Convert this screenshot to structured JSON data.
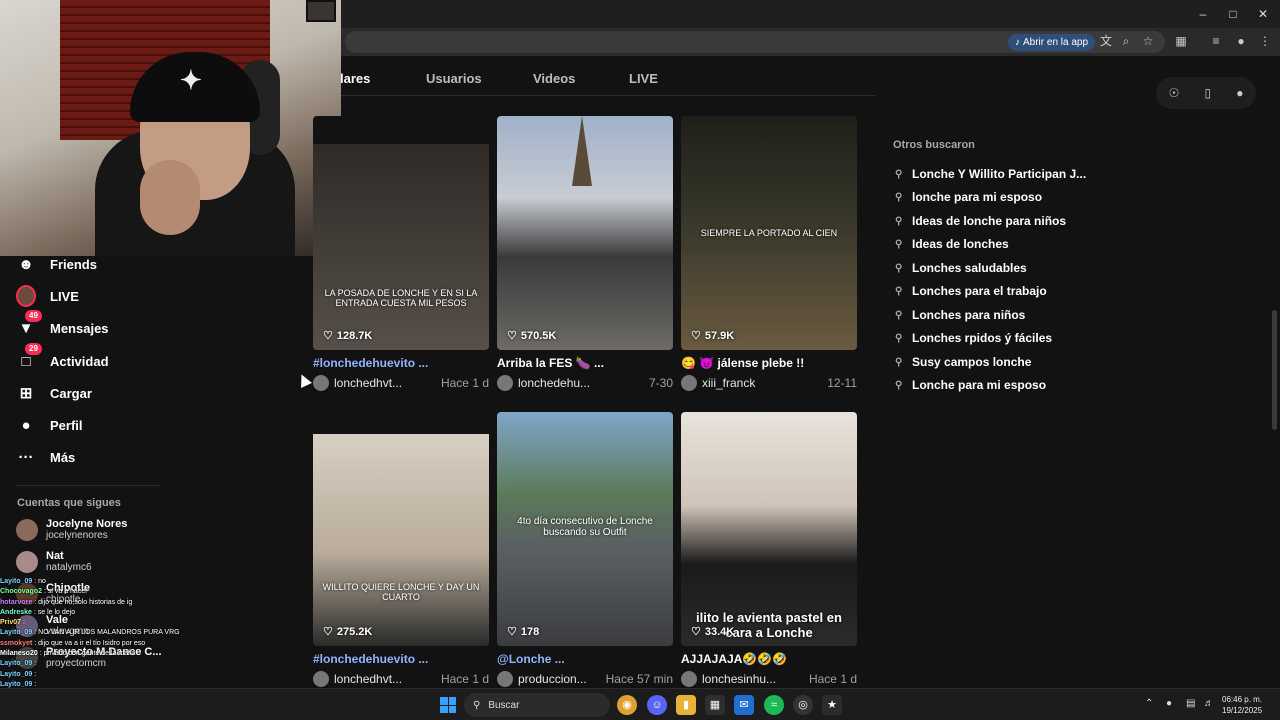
{
  "browser": {
    "open_app_label": "Abrir en la app"
  },
  "tabs": [
    {
      "label": "lares",
      "active": true
    },
    {
      "label": "Usuarios",
      "active": false
    },
    {
      "label": "Videos",
      "active": false
    },
    {
      "label": "LIVE",
      "active": false
    }
  ],
  "nav": {
    "friends": "Friends",
    "live": "LIVE",
    "messages": "Mensajes",
    "messages_badge": "49",
    "activity": "Actividad",
    "activity_badge": "29",
    "upload": "Cargar",
    "profile": "Perfil",
    "more": "Más"
  },
  "following": {
    "title": "Cuentas que sigues",
    "accounts": [
      {
        "name": "Jocelyne Nores",
        "user": "jocelynenores"
      },
      {
        "name": "Nat",
        "user": "natalymc6"
      },
      {
        "name": "Chipotle",
        "user": "chipotle"
      },
      {
        "name": "Vale",
        "user": "valevgmn"
      },
      {
        "name": "Proyecto M Dance C...",
        "user": "proyectomcm"
      }
    ]
  },
  "chat": [
    {
      "user": "Layito_09",
      "user_color": "#7ad3ff",
      "msg": "no"
    },
    {
      "user": "Chocovago2",
      "user_color": "#7aff9a",
      "msg": "si va a hacer"
    },
    {
      "user": "hotarvore",
      "user_color": "#c27aff",
      "msg": "dijo que no,solo historias de ig"
    },
    {
      "user": "Andreske",
      "user_color": "#7affd0",
      "msg": "se le lo dejo"
    },
    {
      "user": "Priv07",
      "user_color": "#ffe07a",
      "msg": ""
    },
    {
      "user": "Layito_09",
      "user_color": "#7ad3ff",
      "msg": "NO VAN A IR LOS MALANDROS PURA VRG"
    },
    {
      "user": "ssmokyet",
      "user_color": "#ff7a7a",
      "msg": "dijo que va a ir el tío Isidro por eso"
    },
    {
      "user": "Milaneso20",
      "user_color": "#ffffff",
      "msg": "privado con gente de la mafia"
    },
    {
      "user": "Layito_09",
      "user_color": "#7ad3ff",
      "msg": ""
    },
    {
      "user": "Layito_09",
      "user_color": "#7ad3ff",
      "msg": ""
    },
    {
      "user": "Layito_09",
      "user_color": "#7ad3ff",
      "msg": ""
    }
  ],
  "videos": [
    {
      "likes": "128.7K",
      "overlay": "LA POSADA DE LONCHE Y EN SI LA ENTRADA CUESTA MIL PESOS",
      "caption": "#lonchedehuevito ...",
      "is_tag": true,
      "user": "lonchedhvt...",
      "time": "Hace 1 d"
    },
    {
      "likes": "570.5K",
      "overlay": "",
      "caption": "Arriba la FES 🍆 ...",
      "is_tag": false,
      "user": "lonchedehu...",
      "time": "7-30"
    },
    {
      "likes": "57.9K",
      "overlay": "SIEMPRE LA PORTADO AL CIEN",
      "caption": "😋 😈 jálense plebe !!",
      "is_tag": false,
      "user": "xiii_franck",
      "time": "12-11"
    },
    {
      "likes": "275.2K",
      "overlay": "WILLITO QUIERE LONCHE Y DAY UN CUARTO",
      "caption": "#lonchedehuevito ...",
      "is_tag": true,
      "user": "lonchedhvt...",
      "time": "Hace 1 d"
    },
    {
      "likes": "178",
      "overlay": "4to día consecutivo de Lonche buscando su Outfit",
      "caption": "@Lonche ...",
      "is_tag": true,
      "user": "produccion...",
      "time": "Hace 57 min"
    },
    {
      "likes": "33.4K",
      "overlay": "ilito le avienta pastel en cara a Lonche",
      "caption": "AJJAJAJA🤣🤣🤣",
      "is_tag": false,
      "user": "lonchesinhu...",
      "time": "Hace 1 d"
    }
  ],
  "related": {
    "title": "Otros buscaron",
    "items": [
      "Lonche Y Willito Participan J...",
      "lonche para mi esposo",
      "Ideas de lonche para niños",
      "Ideas de lonches",
      "Lonches saludables",
      "Lonches para el trabajo",
      "Lonches para niños",
      "Lonches rpidos ý fáciles",
      "Susy campos lonche",
      "Lonche para mi esposo"
    ]
  },
  "taskbar": {
    "search_placeholder": "Buscar",
    "time": "06:46 p. m.",
    "date": "19/12/2025"
  },
  "colors": {
    "accent": "#fe2c55",
    "background": "#121212"
  }
}
